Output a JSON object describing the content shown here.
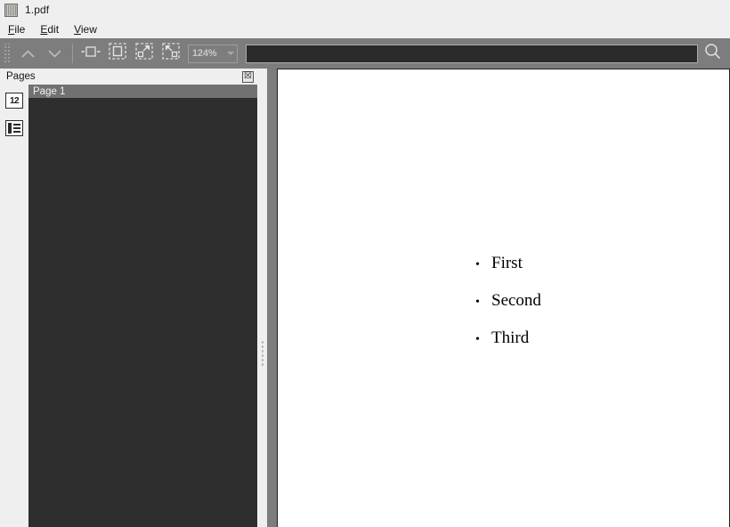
{
  "window": {
    "title": "1.pdf",
    "app_icon": "document-thumbnail-icon"
  },
  "menubar": {
    "items": [
      {
        "accel": "F",
        "rest": "ile",
        "name": "file"
      },
      {
        "accel": "E",
        "rest": "dit",
        "name": "edit"
      },
      {
        "accel": "V",
        "rest": "iew",
        "name": "view"
      }
    ]
  },
  "toolbar": {
    "drag_handle": "toolbar-drag-handle",
    "prev_page": "previous-page-chevron-up-icon",
    "next_page": "next-page-chevron-down-icon",
    "fit_width": "fit-width-icon",
    "fit_page": "fit-page-icon",
    "zoom_in": "zoom-in-icon",
    "zoom_out": "zoom-out-icon",
    "zoom_value": "124%",
    "zoom_caret": "chevron-down-icon"
  },
  "search": {
    "value": "",
    "placeholder": "",
    "button_icon": "magnifier-icon"
  },
  "sidebar": {
    "pane_title": "Pages",
    "close_label": "☒",
    "rail": [
      {
        "name": "page-thumbnails-view",
        "label": "12",
        "type": "number"
      },
      {
        "name": "outline-view",
        "label": "",
        "type": "list"
      }
    ],
    "pages": [
      {
        "label": "Page 1",
        "selected": true
      }
    ]
  },
  "document": {
    "items": [
      {
        "bullet": "•",
        "text": "First"
      },
      {
        "bullet": "•",
        "text": "Second"
      },
      {
        "bullet": "•",
        "text": "Third"
      }
    ]
  },
  "colors": {
    "chrome": "#efefef",
    "toolbar": "#7d7d7d",
    "panel_dark": "#2e2e2e",
    "selection": "#717171",
    "page": "#ffffff"
  }
}
